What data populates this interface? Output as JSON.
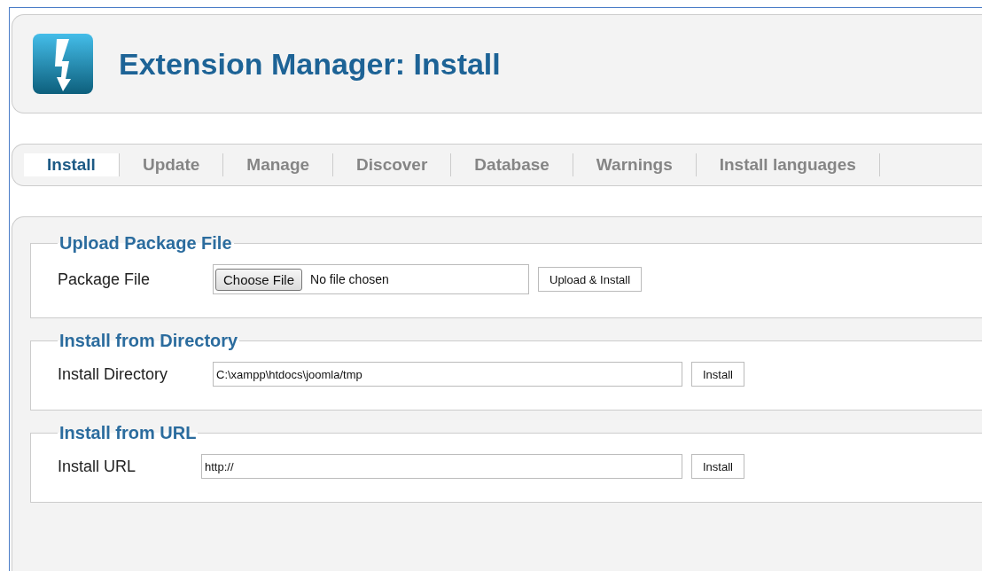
{
  "header": {
    "title": "Extension Manager: Install"
  },
  "tabs": [
    {
      "label": "Install",
      "selected": true
    },
    {
      "label": "Update",
      "selected": false
    },
    {
      "label": "Manage",
      "selected": false
    },
    {
      "label": "Discover",
      "selected": false
    },
    {
      "label": "Database",
      "selected": false
    },
    {
      "label": "Warnings",
      "selected": false
    },
    {
      "label": "Install languages",
      "selected": false
    }
  ],
  "sections": [
    {
      "legend": "Upload Package File",
      "label": "Package File",
      "kind": "file",
      "choose_label": "Choose File",
      "file_status": "No file chosen",
      "button": "Upload & Install"
    },
    {
      "legend": "Install from Directory",
      "label": "Install Directory",
      "kind": "text",
      "value": "C:\\xampp\\htdocs\\joomla/tmp",
      "button": "Install"
    },
    {
      "legend": "Install from URL",
      "label": "Install URL",
      "kind": "text",
      "value": "http://",
      "button": "Install"
    }
  ]
}
